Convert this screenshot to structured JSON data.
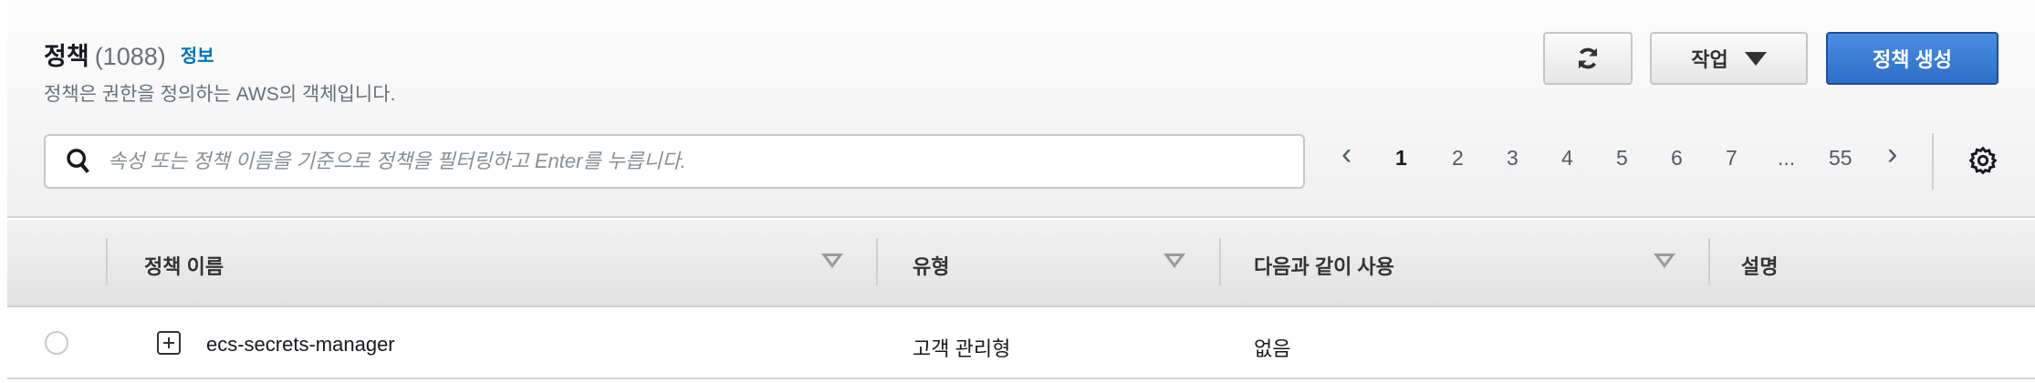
{
  "header": {
    "title": "정책",
    "count": "(1088)",
    "info_link": "정보",
    "subtitle": "정책은 권한을 정의하는 AWS의 객체입니다."
  },
  "actions": {
    "refresh_icon": "refresh-icon",
    "actions_label": "작업",
    "create_label": "정책 생성",
    "primary_color": "#2e6ec8"
  },
  "search": {
    "placeholder": "속성 또는 정책 이름을 기준으로 정책을 필터링하고 Enter를 누릅니다.",
    "value": ""
  },
  "pagination": {
    "prev": "‹",
    "pages": [
      "1",
      "2",
      "3",
      "4",
      "5",
      "6",
      "7"
    ],
    "ellipsis": "...",
    "last": "55",
    "next": "›",
    "current": "1"
  },
  "table": {
    "columns": [
      "정책 이름",
      "유형",
      "다음과 같이 사용",
      "설명"
    ],
    "rows": [
      {
        "name": "ecs-secrets-manager",
        "type": "고객 관리형",
        "used_as": "없음",
        "description": ""
      }
    ]
  }
}
